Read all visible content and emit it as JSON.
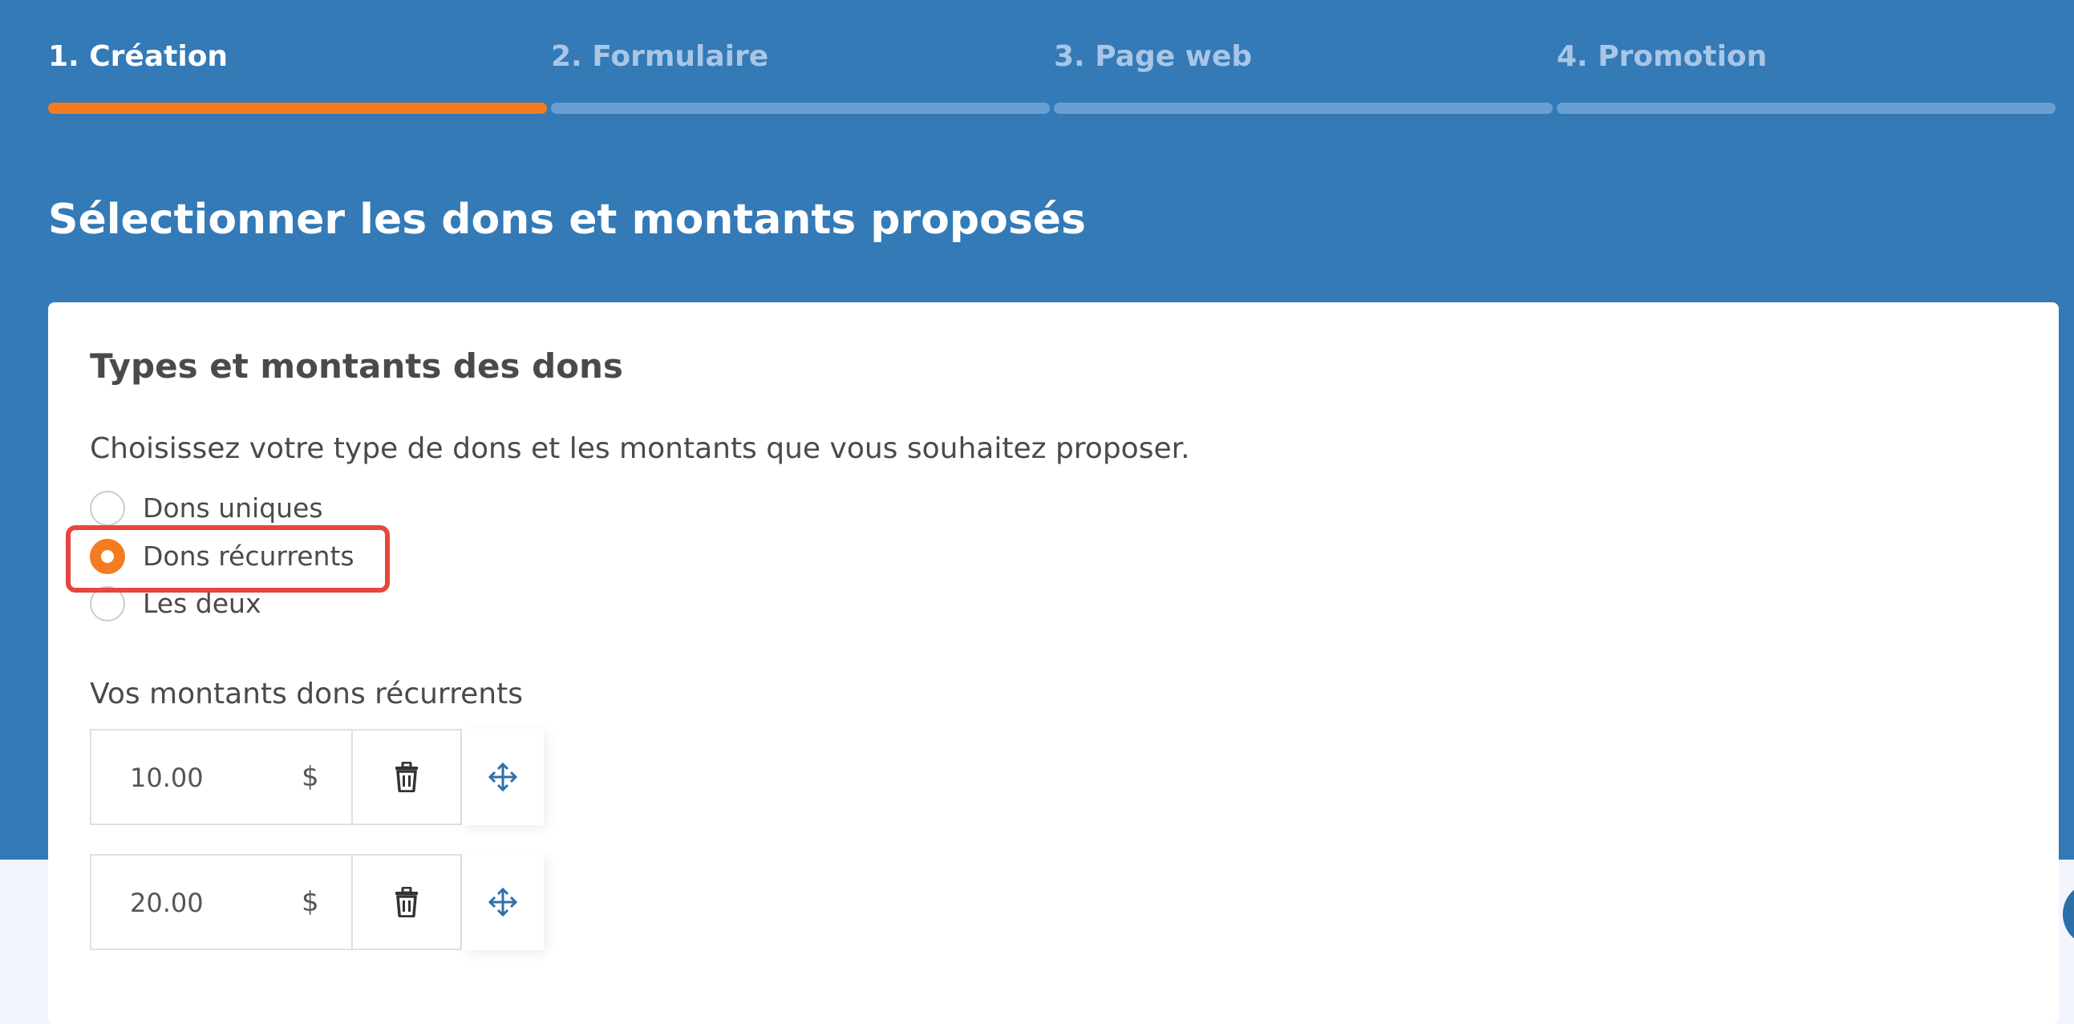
{
  "stepper": {
    "steps": [
      {
        "label": "1. Création",
        "active": true
      },
      {
        "label": "2. Formulaire",
        "active": false
      },
      {
        "label": "3. Page web",
        "active": false
      },
      {
        "label": "4. Promotion",
        "active": false
      }
    ]
  },
  "page": {
    "title": "Sélectionner les dons et montants proposés"
  },
  "card": {
    "title": "Types et montants des dons",
    "description": "Choisissez votre type de dons et les montants que vous souhaitez proposer.",
    "donation_types": [
      {
        "label": "Dons uniques",
        "selected": false
      },
      {
        "label": "Dons récurrents",
        "selected": true
      },
      {
        "label": "Les deux",
        "selected": false
      }
    ],
    "amounts_label": "Vos montants dons récurrents",
    "amounts": [
      {
        "value": "10.00",
        "currency": "$"
      },
      {
        "value": "20.00",
        "currency": "$"
      }
    ]
  },
  "icons": {
    "delete": "trash-icon",
    "move": "move-arrows-icon"
  },
  "colors": {
    "header_bg": "#337ab7",
    "accent": "#f47c20",
    "highlight": "#e8453c"
  }
}
